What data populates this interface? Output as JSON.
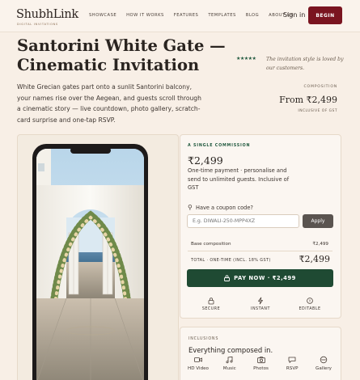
{
  "brand": {
    "name": "ShubhLink",
    "tagline": "DIGITAL INVITATIONS"
  },
  "nav": {
    "items": [
      {
        "label": "SHOWCASE",
        "name": "nav-showcase"
      },
      {
        "label": "HOW IT WORKS",
        "name": "nav-how-it-works"
      },
      {
        "label": "FEATURES",
        "name": "nav-features"
      },
      {
        "label": "TEMPLATES",
        "name": "nav-templates"
      },
      {
        "label": "BLOG",
        "name": "nav-blog"
      },
      {
        "label": "ABOUT US",
        "name": "nav-about-us"
      }
    ],
    "signin_label": "Sign in",
    "begin_label": "BEGIN"
  },
  "hero": {
    "title": "Santorini White Gate — Cinematic Invitation",
    "description": "White Grecian gates part onto a sunlit Santorini balcony, your names rise over the Aegean, and guests scroll through a cinematic story — live countdown, photo gallery, scratch-card surprise and one-tap RSVP.",
    "stars": "★★★★★",
    "rating_text": "The invitation style is loved by our customers."
  },
  "composition": {
    "label": "COMPOSITION",
    "price": "From ₹2,499",
    "gst_note": "INCLUSIVE OF GST"
  },
  "purchase": {
    "label": "A SINGLE COMMISSION",
    "price": "₹2,499",
    "description": "One-time payment · personalise and send to unlimited guests. Inclusive of GST",
    "coupon_label": "Have a coupon code?",
    "coupon_placeholder": "E.g. DIWALI-250-MPP4XZ",
    "apply_label": "Apply",
    "base_label": "Base composition",
    "base_value": "₹2,499",
    "total_label": "TOTAL · ONE-TIME (INCL. 18% GST)",
    "total_value": "₹2,499",
    "pay_label": "PAY NOW · ₹2,499",
    "features": [
      {
        "label": "SECURE",
        "icon": "lock-icon"
      },
      {
        "label": "INSTANT",
        "icon": "lightning-icon"
      },
      {
        "label": "EDITABLE",
        "icon": "info-icon"
      }
    ]
  },
  "inclusions": {
    "label": "INCLUSIONS",
    "title": "Everything composed in.",
    "items": [
      {
        "label": "HD Video",
        "icon": "video-icon"
      },
      {
        "label": "Music",
        "icon": "music-icon"
      },
      {
        "label": "Photos",
        "icon": "camera-icon"
      },
      {
        "label": "RSVP",
        "icon": "rsvp-icon"
      },
      {
        "label": "Gallery",
        "icon": "gallery-icon"
      }
    ]
  },
  "colors": {
    "background": "#f8efe6",
    "brand_red": "#7a1420",
    "pay_green": "#1f4a33",
    "accent_green": "#20593e"
  }
}
